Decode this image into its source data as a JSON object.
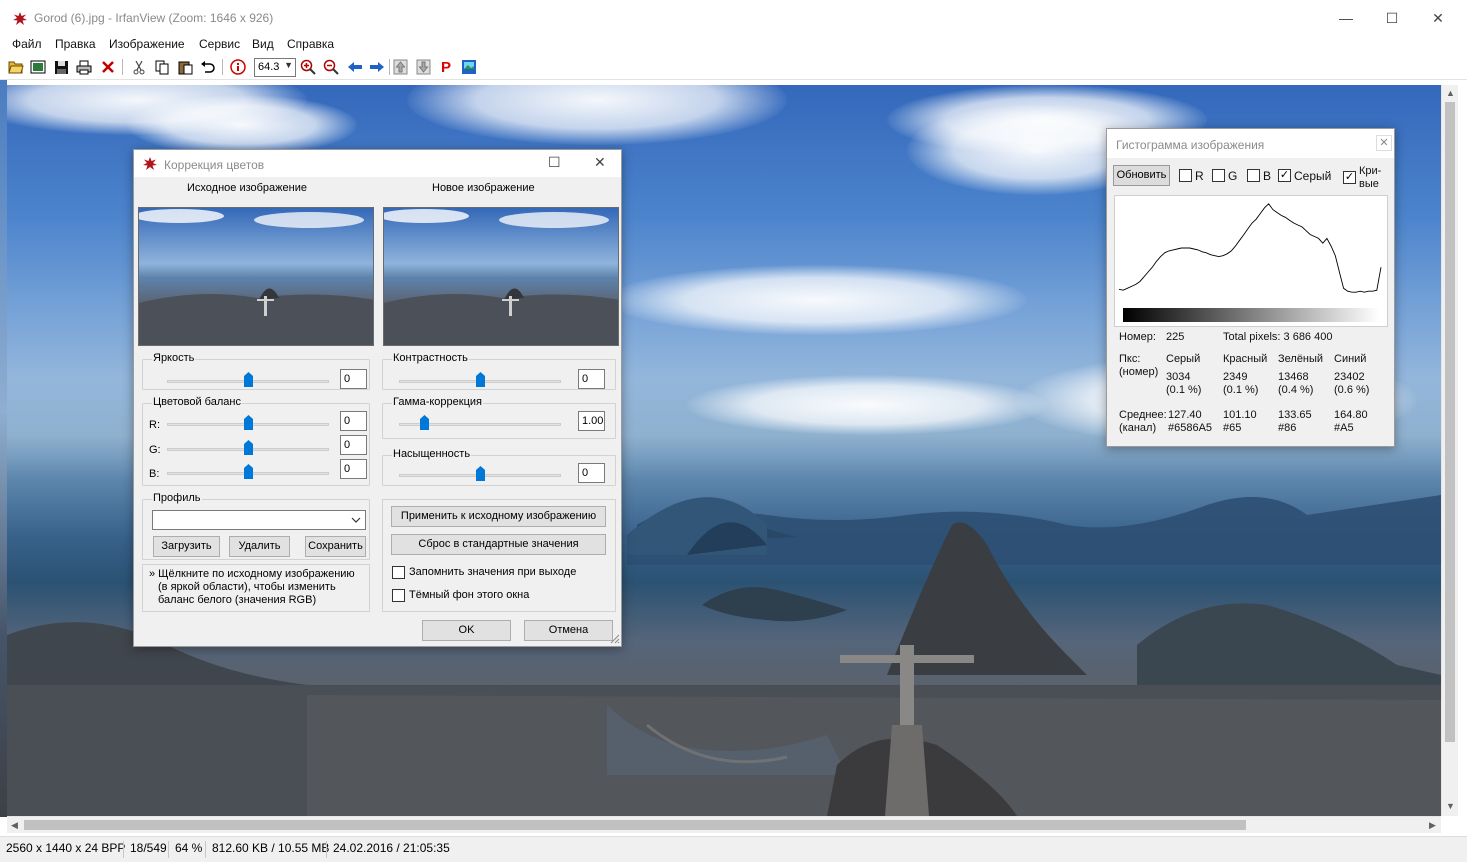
{
  "window": {
    "title": "Gorod (6).jpg - IrfanView (Zoom: 1646 x 926)",
    "minimize": "—",
    "maximize": "☐",
    "close": "✕"
  },
  "menu": [
    "Файл",
    "Правка",
    "Изображение",
    "Сервис",
    "Вид",
    "Справка"
  ],
  "toolbar": {
    "zoom_value": "64.3",
    "icons": [
      "open-icon",
      "thumbnails-icon",
      "save-icon",
      "print-icon",
      "delete-icon",
      "cut-icon",
      "copy-icon",
      "paste-icon",
      "undo-icon",
      "info-icon",
      "zoom-select",
      "zoom-in-icon",
      "zoom-out-icon",
      "previous-icon",
      "next-icon",
      "first-page-icon",
      "last-page-icon",
      "plugin-p-icon",
      "slideshow-icon"
    ]
  },
  "status": {
    "dimensions": "2560 x 1440 x 24 BPP",
    "index": "18/549",
    "zoom": "64 %",
    "size": "812.60 KB / 10.55 MB",
    "datetime": "24.02.2016 / 21:05:35"
  },
  "color_dialog": {
    "title": "Коррекция цветов",
    "original_label": "Исходное изображение",
    "new_label": "Новое изображение",
    "brightness": {
      "label": "Яркость",
      "value": "0",
      "level": 0.5
    },
    "contrast": {
      "label": "Контрастность",
      "value": "0",
      "level": 0.5
    },
    "color_balance": {
      "label": "Цветовой баланс",
      "r": {
        "label": "R:",
        "value": "0",
        "level": 0.5
      },
      "g": {
        "label": "G:",
        "value": "0",
        "level": 0.5
      },
      "b": {
        "label": "B:",
        "value": "0",
        "level": 0.5
      }
    },
    "gamma": {
      "label": "Гамма-коррекция",
      "value": "1.00",
      "level": 0.16
    },
    "saturation": {
      "label": "Насыщенность",
      "value": "0",
      "level": 0.5
    },
    "profile": {
      "label": "Профиль",
      "selected": "",
      "load": "Загрузить",
      "delete": "Удалить",
      "save": "Сохранить"
    },
    "hint_line1": "» Щёлкните по исходному изображению",
    "hint_line2": "(в яркой области), чтобы изменить",
    "hint_line3": "баланс белого (значения RGB)",
    "apply_original": "Применить к исходному изображению",
    "reset": "Сброс в стандартные значения",
    "remember_on_exit": {
      "label": "Запомнить значения при выходе",
      "checked": false
    },
    "dark_background": {
      "label": "Тёмный фон этого окна",
      "checked": false
    },
    "ok": "OK",
    "cancel": "Отмена"
  },
  "histogram": {
    "title": "Гистограмма изображения",
    "refresh": "Обновить",
    "channels": [
      {
        "label": "R",
        "checked": false
      },
      {
        "label": "G",
        "checked": false
      },
      {
        "label": "B",
        "checked": false
      },
      {
        "label": "Серый",
        "checked": true
      }
    ],
    "curves": {
      "label_line1": "Кри-",
      "label_line2": "вые",
      "checked": true
    },
    "gray_curve": [
      0.07,
      0.06,
      0.08,
      0.1,
      0.12,
      0.15,
      0.2,
      0.25,
      0.3,
      0.36,
      0.41,
      0.45,
      0.47,
      0.48,
      0.49,
      0.5,
      0.5,
      0.5,
      0.49,
      0.48,
      0.46,
      0.45,
      0.43,
      0.42,
      0.41,
      0.42,
      0.44,
      0.47,
      0.52,
      0.58,
      0.64,
      0.7,
      0.76,
      0.8,
      0.86,
      0.92,
      0.96,
      0.9,
      0.87,
      0.84,
      0.82,
      0.79,
      0.76,
      0.74,
      0.72,
      0.68,
      0.64,
      0.62,
      0.6,
      0.55,
      0.6,
      0.52,
      0.42,
      0.25,
      0.08,
      0.05,
      0.04,
      0.04,
      0.05,
      0.04,
      0.05,
      0.05,
      0.06,
      0.3
    ],
    "number_label": "Номер:",
    "number_value": "225",
    "total_pixels": "Total pixels: 3 686 400",
    "pix_label_line1": "Пкс:",
    "pix_label_line2": "(номер)",
    "columns": [
      "Серый",
      "Красный",
      "Зелёный",
      "Синий"
    ],
    "pix_counts": [
      "3034",
      "2349",
      "13468",
      "23402"
    ],
    "pix_percents": [
      "(0.1 %)",
      "(0.1 %)",
      "(0.4 %)",
      "(0.6 %)"
    ],
    "mean_label_line1": "Среднее:",
    "mean_label_line2": "(канал)",
    "means": [
      "127.40",
      "101.10",
      "133.65",
      "164.80"
    ],
    "mean_hex": [
      "#6586A5",
      "#65",
      "#86",
      "#A5"
    ]
  },
  "colors": {
    "accent": "#0078d7",
    "zoom_in": "#c00000",
    "arrow": "#1e62c8",
    "plugin": "#e00000"
  }
}
